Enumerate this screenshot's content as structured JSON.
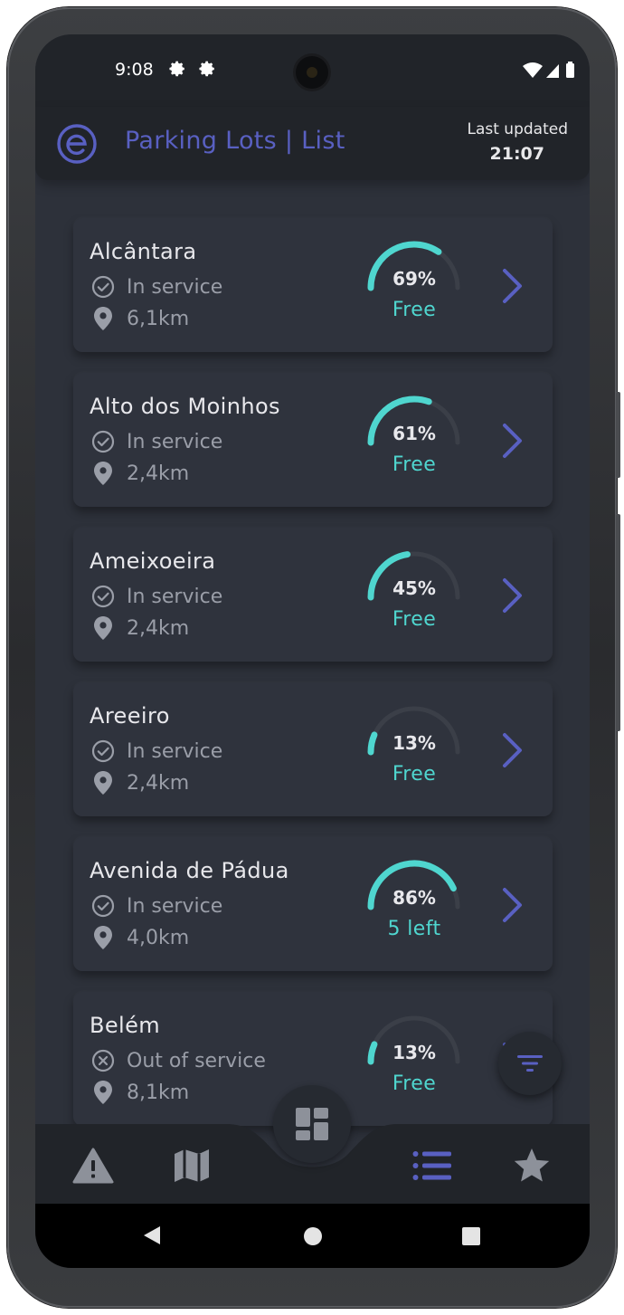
{
  "status_bar": {
    "time": "9:08",
    "icons": [
      "gear-icon",
      "gear-icon",
      "wifi-icon",
      "signal-icon",
      "battery-icon"
    ]
  },
  "header": {
    "title": "Parking Lots | List",
    "last_updated_label": "Last updated",
    "last_updated_time": "21:07",
    "logo_icon": "app-logo-e-icon"
  },
  "lots": [
    {
      "name": "Alcântara",
      "status": "In service",
      "status_icon": "check-circle-icon",
      "distance": "6,1km",
      "occupancy": 69,
      "occupancy_text": "69%",
      "availability": "Free"
    },
    {
      "name": "Alto dos Moinhos",
      "status": "In service",
      "status_icon": "check-circle-icon",
      "distance": "2,4km",
      "occupancy": 61,
      "occupancy_text": "61%",
      "availability": "Free"
    },
    {
      "name": "Ameixoeira",
      "status": "In service",
      "status_icon": "check-circle-icon",
      "distance": "2,4km",
      "occupancy": 45,
      "occupancy_text": "45%",
      "availability": "Free"
    },
    {
      "name": "Areeiro",
      "status": "In service",
      "status_icon": "check-circle-icon",
      "distance": "2,4km",
      "occupancy": 13,
      "occupancy_text": "13%",
      "availability": "Free"
    },
    {
      "name": "Avenida de Pádua",
      "status": "In service",
      "status_icon": "check-circle-icon",
      "distance": "4,0km",
      "occupancy": 86,
      "occupancy_text": "86%",
      "availability": "5 left"
    },
    {
      "name": "Belém",
      "status": "Out of service",
      "status_icon": "x-circle-icon",
      "distance": "8,1km",
      "occupancy": 13,
      "occupancy_text": "13%",
      "availability": "Free"
    }
  ],
  "bottom_nav": {
    "items": [
      "warning-icon",
      "map-icon",
      "dashboard-icon",
      "list-icon",
      "star-icon"
    ],
    "active": "list-icon"
  },
  "colors": {
    "accent": "#5960c2",
    "teal": "#4fd6cf",
    "card": "#2f333d",
    "background": "#2d313a"
  }
}
